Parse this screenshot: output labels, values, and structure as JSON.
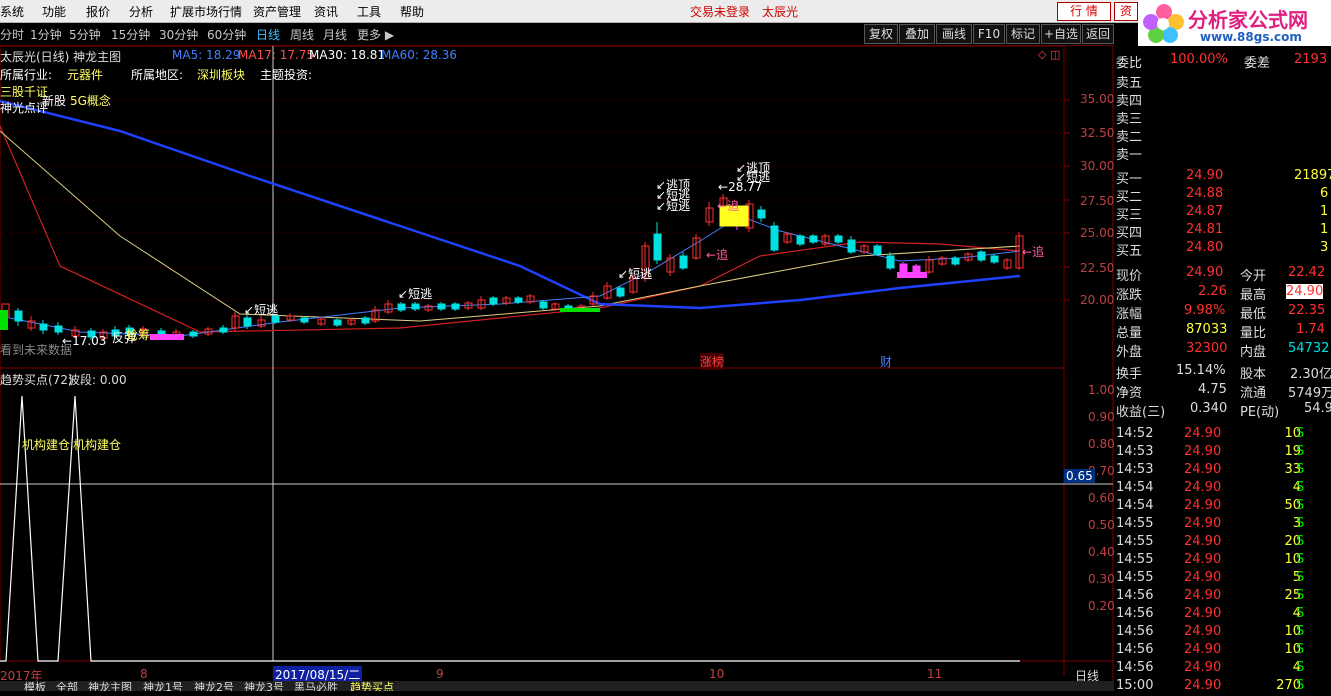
{
  "menu": [
    "系统",
    "功能",
    "报价",
    "分析",
    "扩展市场行情",
    "资产管理",
    "资讯",
    "工具",
    "帮助"
  ],
  "menu_status": "交易未登录",
  "menu_stock": "太辰光",
  "menu_btn": "行 情",
  "menu_btn2": "资",
  "logo": {
    "brand": "分析家公式网",
    "url": "www.88gs.com"
  },
  "periods": [
    "分时",
    "1分钟",
    "5分钟",
    "15分钟",
    "30分钟",
    "60分钟",
    "日线",
    "周线",
    "月线",
    "更多 ▶"
  ],
  "active_period": "日线",
  "right_buttons": [
    "复权",
    "叠加",
    "画线",
    "F10",
    "标记",
    "+自选",
    "返回"
  ],
  "main": {
    "title": "太辰光(日线) 神龙主图",
    "ma": [
      {
        "label": "MA5: 18.29",
        "color": "#4080ff"
      },
      {
        "label": "MA17: 17.75",
        "color": "#ff5050"
      },
      {
        "label": "MA30: 18.81",
        "color": "#ffffff"
      },
      {
        "label": "MA60: 28.36",
        "color": "#4080ff"
      }
    ],
    "industry_label": "所属行业:",
    "industry": "元器件",
    "region_label": "所属地区:",
    "region": "深圳板块",
    "theme_label": "主题投资:",
    "tag1": "三股千证",
    "tag2": "新股",
    "tag3": "5G概念",
    "tag4": "神光点评",
    "no_future": "看到未来数据",
    "low_label": "17.03",
    "high_label": "28.77",
    "signals": [
      "短逃",
      "短逃",
      "短逃",
      "逃顶",
      "短逃",
      "短逃",
      "逃顶",
      "短逃",
      "追",
      "追",
      "追",
      "反弹",
      "抢筹"
    ],
    "events": [
      "涨榜",
      "财"
    ],
    "price_ticks": [
      "35.00",
      "32.50",
      "30.00",
      "27.50",
      "25.00",
      "22.50",
      "20.00"
    ]
  },
  "sub": {
    "title": "趋势买点(72)",
    "wave": "波段: 0.00",
    "label1": "机构建仓",
    "label2": "机构建仓",
    "ticks": [
      "1.00",
      "0.90",
      "0.80",
      "0.70",
      "0.60",
      "0.50",
      "0.40",
      "0.30",
      "0.20"
    ],
    "cursor_value": "0.65"
  },
  "xaxis": {
    "labels": [
      "2017年",
      "8",
      "9",
      "10",
      "11"
    ],
    "cursor_date": "2017/08/15/二",
    "period": "日线"
  },
  "bottom_tabs": [
    "模板",
    "全部",
    "神龙主图",
    "神龙1号",
    "神龙2号",
    "神龙3号",
    "黑马必胜",
    "趋势买点"
  ],
  "quote": {
    "weibi": {
      "label": "委比",
      "value": "100.00%",
      "label2": "委差",
      "value2": "2193"
    },
    "asks": [
      "卖五",
      "卖四",
      "卖三",
      "卖二",
      "卖一"
    ],
    "bids": [
      {
        "label": "买一",
        "price": "24.90",
        "vol": "21897"
      },
      {
        "label": "买二",
        "price": "24.88",
        "vol": "6"
      },
      {
        "label": "买三",
        "price": "24.87",
        "vol": "1"
      },
      {
        "label": "买四",
        "price": "24.81",
        "vol": "1"
      },
      {
        "label": "买五",
        "price": "24.80",
        "vol": "3"
      }
    ],
    "stats": [
      {
        "l": "现价",
        "v": "24.90",
        "l2": "今开",
        "v2": "22.42"
      },
      {
        "l": "涨跌",
        "v": "2.26",
        "l2": "最高",
        "v2": "24.90"
      },
      {
        "l": "涨幅",
        "v": "9.98%",
        "l2": "最低",
        "v2": "22.35"
      },
      {
        "l": "总量",
        "v": "87033",
        "l2": "量比",
        "v2": "1.74"
      },
      {
        "l": "外盘",
        "v": "32300",
        "l2": "内盘",
        "v2": "54732"
      }
    ],
    "stats2": [
      {
        "l": "换手",
        "v": "15.14%",
        "l2": "股本",
        "v2": "2.30亿"
      },
      {
        "l": "净资",
        "v": "4.75",
        "l2": "流通",
        "v2": "5749万"
      },
      {
        "l": "收益(三)",
        "v": "0.340",
        "l2": "PE(动)",
        "v2": "54.9"
      }
    ],
    "ticks": [
      {
        "t": "14:52",
        "p": "24.90",
        "v": "10",
        "s": "S"
      },
      {
        "t": "14:53",
        "p": "24.90",
        "v": "19",
        "s": "S"
      },
      {
        "t": "14:53",
        "p": "24.90",
        "v": "33",
        "s": "S"
      },
      {
        "t": "14:54",
        "p": "24.90",
        "v": "4",
        "s": "S"
      },
      {
        "t": "14:54",
        "p": "24.90",
        "v": "50",
        "s": "S"
      },
      {
        "t": "14:55",
        "p": "24.90",
        "v": "3",
        "s": "S"
      },
      {
        "t": "14:55",
        "p": "24.90",
        "v": "20",
        "s": "S"
      },
      {
        "t": "14:55",
        "p": "24.90",
        "v": "10",
        "s": "S"
      },
      {
        "t": "14:55",
        "p": "24.90",
        "v": "5",
        "s": "S"
      },
      {
        "t": "14:56",
        "p": "24.90",
        "v": "25",
        "s": "S"
      },
      {
        "t": "14:56",
        "p": "24.90",
        "v": "4",
        "s": "S"
      },
      {
        "t": "14:56",
        "p": "24.90",
        "v": "10",
        "s": "S"
      },
      {
        "t": "14:56",
        "p": "24.90",
        "v": "10",
        "s": "S"
      },
      {
        "t": "14:56",
        "p": "24.90",
        "v": "4",
        "s": "S"
      },
      {
        "t": "15:00",
        "p": "24.90",
        "v": "270",
        "s": "S"
      }
    ]
  },
  "colors": {
    "up": "#ff3030",
    "down": "#00e0e0",
    "yellow": "#ffff40",
    "label": "#c0c0c0"
  }
}
